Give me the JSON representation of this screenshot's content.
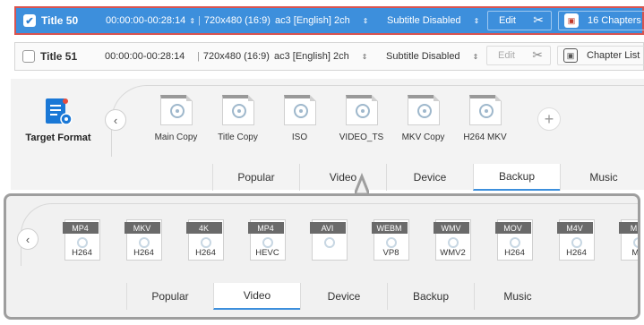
{
  "titles": [
    {
      "name": "Title 50",
      "checked": true,
      "time": "00:00:00-00:28:14",
      "resolution": "720x480 (16:9)",
      "audio": "ac3 [English] 2ch",
      "subtitle": "Subtitle Disabled",
      "edit": "Edit",
      "chapters": "16 Chapters"
    },
    {
      "name": "Title 51",
      "checked": false,
      "time": "00:00:00-00:28:14",
      "resolution": "720x480 (16:9)",
      "audio": "ac3 [English] 2ch",
      "subtitle": "Subtitle Disabled",
      "edit": "Edit",
      "chapters": "Chapter List"
    }
  ],
  "target_format": {
    "label": "Target Format"
  },
  "backup_formats": [
    "Main Copy",
    "Title Copy",
    "ISO",
    "VIDEO_TS",
    "MKV Copy",
    "H264 MKV"
  ],
  "tabs_upper": [
    "Popular",
    "Video",
    "Device",
    "Backup",
    "Music"
  ],
  "upper_active_tab": "Backup",
  "video_formats": [
    {
      "container": "MP4",
      "codec": "H264"
    },
    {
      "container": "MKV",
      "codec": "H264"
    },
    {
      "container": "4K",
      "codec": "H264"
    },
    {
      "container": "MP4",
      "codec": "HEVC"
    },
    {
      "container": "AVI",
      "codec": ""
    },
    {
      "container": "WEBM",
      "codec": "VP8"
    },
    {
      "container": "WMV",
      "codec": "WMV2"
    },
    {
      "container": "MOV",
      "codec": "H264"
    },
    {
      "container": "M4V",
      "codec": "H264"
    },
    {
      "container": "MP",
      "codec": "MP"
    }
  ],
  "tabs_lower": [
    "",
    "Popular",
    "Video",
    "Device",
    "Backup",
    "Music"
  ],
  "lower_active_tab": "Video",
  "colors": {
    "accent": "#3d8fdc",
    "highlight_border": "#d9534f"
  }
}
